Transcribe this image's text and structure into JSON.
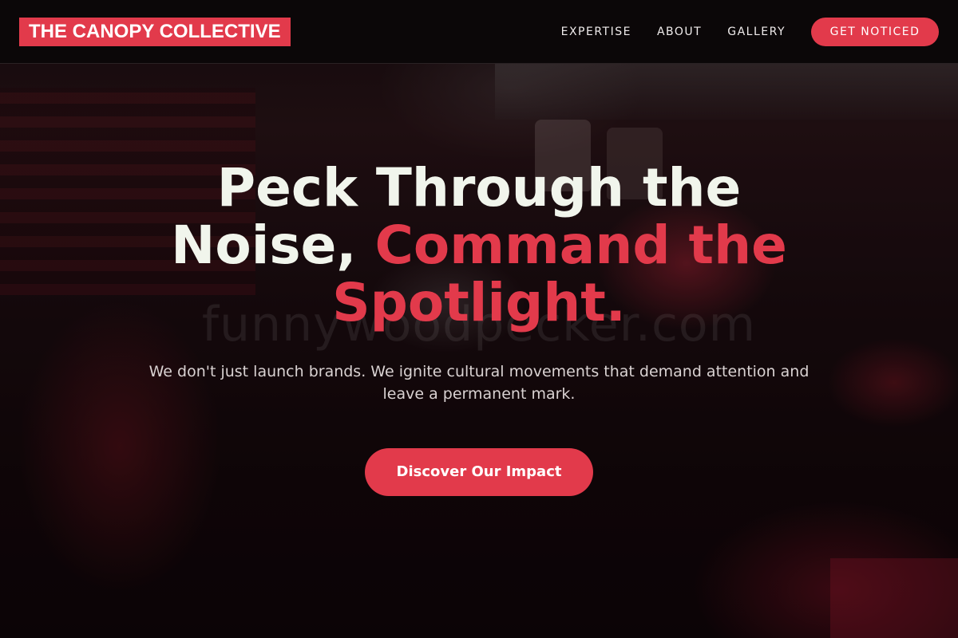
{
  "brand": {
    "logo_text": "THE CANOPY COLLECTIVE",
    "accent_color": "#e23a4b"
  },
  "nav": {
    "links": [
      "EXPERTISE",
      "ABOUT",
      "GALLERY"
    ],
    "cta_label": "GET NOTICED"
  },
  "hero": {
    "headline_part1": "Peck Through the Noise, ",
    "headline_accent": "Command the Spotlight.",
    "subtext": "We don't just launch brands. We ignite cultural movements that demand attention and leave a permanent mark.",
    "cta_label": "Discover Our Impact",
    "watermark": "funnywoodpecker.com",
    "background_image": "nightlife-crowd-photo"
  }
}
